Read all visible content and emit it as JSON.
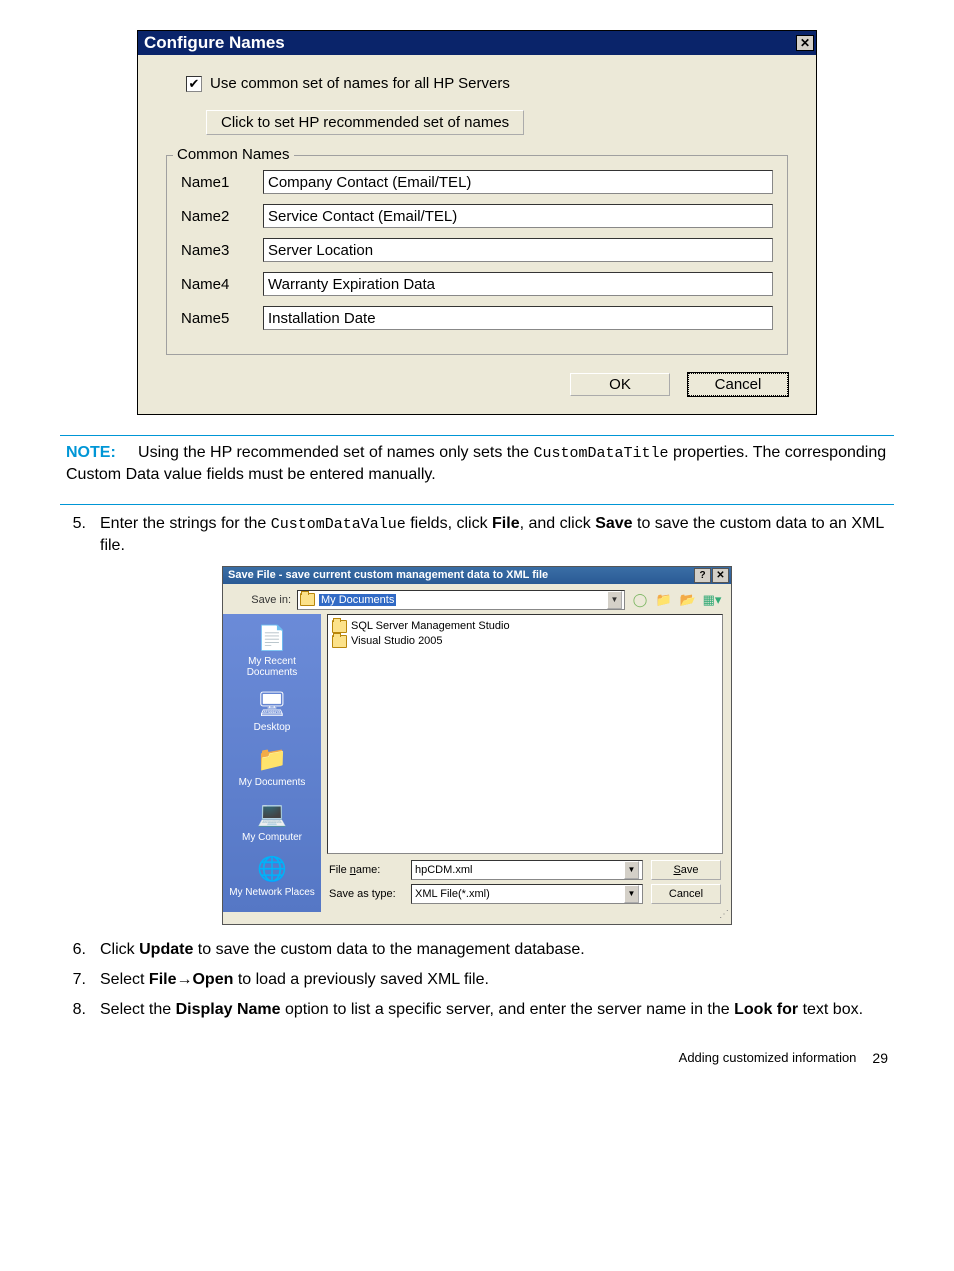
{
  "dialog1": {
    "title": "Configure Names",
    "checkbox_label": "Use common set of names for all HP Servers",
    "recommend_btn": "Click to set HP recommended set of names",
    "group_legend": "Common Names",
    "names": [
      {
        "label": "Name1",
        "value": "Company Contact (Email/TEL)"
      },
      {
        "label": "Name2",
        "value": "Service Contact (Email/TEL)"
      },
      {
        "label": "Name3",
        "value": "Server Location"
      },
      {
        "label": "Name4",
        "value": "Warranty Expiration Data"
      },
      {
        "label": "Name5",
        "value": "Installation Date"
      }
    ],
    "ok": "OK",
    "cancel": "Cancel"
  },
  "note": {
    "label": "NOTE:",
    "text_pre": "Using the HP recommended set of names only sets the ",
    "code": "CustomDataTitle",
    "text_post": " properties. The corresponding Custom Data value fields must be entered manually."
  },
  "step5": {
    "num": "5.",
    "pre": "Enter the strings for the ",
    "code": "CustomDataValue",
    "mid": " fields, click ",
    "b1": "File",
    "mid2": ", and click ",
    "b2": "Save",
    "post": " to save the custom data to an XML file."
  },
  "dialog2": {
    "title": "Save File - save current custom management data to XML file",
    "savein_label": "Save in:",
    "savein_value": "My Documents",
    "files": [
      "SQL Server Management Studio",
      "Visual Studio 2005"
    ],
    "sidebar": [
      "My Recent Documents",
      "Desktop",
      "My Documents",
      "My Computer",
      "My Network Places"
    ],
    "filename_label": "File name:",
    "filename_value": "hpCDM.xml",
    "saveastype_label": "Save as type:",
    "saveastype_value": "XML File(*.xml)",
    "save_btn": "Save",
    "cancel_btn": "Cancel"
  },
  "step6": {
    "num": "6.",
    "pre": "Click ",
    "b1": "Update",
    "post": " to save the custom data to the management database."
  },
  "step7": {
    "num": "7.",
    "pre": "Select ",
    "b1": "File",
    "arrow": "→",
    "b2": "Open",
    "post": " to load a previously saved XML file."
  },
  "step8": {
    "num": "8.",
    "pre": "Select the ",
    "b1": "Display Name",
    "mid": " option to list a specific server, and enter the server name in the ",
    "b2": "Look for",
    "post": " text box."
  },
  "footer": {
    "text": "Adding customized information",
    "page": "29"
  }
}
